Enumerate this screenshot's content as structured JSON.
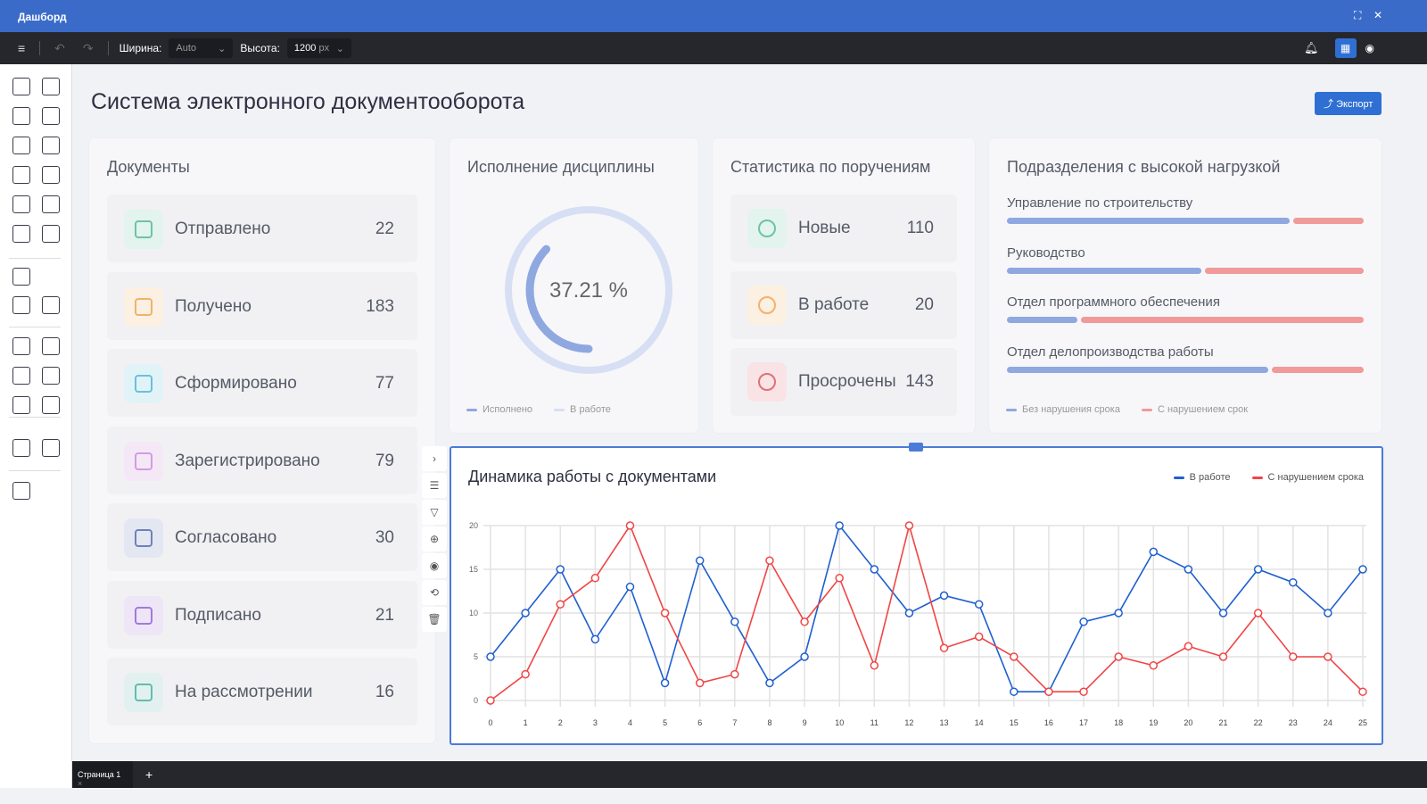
{
  "window": {
    "title": "Дашборд",
    "maximize_icon": "⛶",
    "close_icon": "✕"
  },
  "toolbar": {
    "width_label": "Ширина:",
    "width_value": "Auto",
    "height_label": "Высота:",
    "height_value": "1200",
    "height_unit": "px"
  },
  "page": {
    "title": "Система электронного документооборота",
    "export_label": "Экспорт"
  },
  "documents": {
    "title": "Документы",
    "items": [
      {
        "label": "Отправлено",
        "value": "22",
        "color": "#e3f3ee",
        "icon_color": "#6cc4a4"
      },
      {
        "label": "Получено",
        "value": "183",
        "color": "#fbf0e2",
        "icon_color": "#f2b26a"
      },
      {
        "label": "Сформировано",
        "value": "77",
        "color": "#e2f3f8",
        "icon_color": "#64c3de"
      },
      {
        "label": "Зарегистрировано",
        "value": "79",
        "color": "#f4e8f7",
        "icon_color": "#d49be3"
      },
      {
        "label": "Согласовано",
        "value": "30",
        "color": "#e3e7f2",
        "icon_color": "#6f82b8"
      },
      {
        "label": "Подписано",
        "value": "21",
        "color": "#eee6f7",
        "icon_color": "#a27ad9"
      },
      {
        "label": "На рассмотрении",
        "value": "16",
        "color": "#e2f1ef",
        "icon_color": "#5fbdb1"
      }
    ]
  },
  "discipline": {
    "title": "Исполнение дисциплины",
    "percent": 37.21,
    "percent_label": "37.21 %",
    "legend": [
      "Исполнено",
      "В работе"
    ]
  },
  "assignments": {
    "title": "Статистика по поручениям",
    "items": [
      {
        "label": "Новые",
        "value": "110",
        "color": "#e3f3ee",
        "icon_color": "#6cc4a4"
      },
      {
        "label": "В работе",
        "value": "20",
        "color": "#fbf0e2",
        "icon_color": "#f2b26a"
      },
      {
        "label": "Просрочены",
        "value": "143",
        "color": "#f9e3e5",
        "icon_color": "#e0707a"
      }
    ]
  },
  "departments": {
    "title": "Подразделения с высокой нагрузкой",
    "items": [
      {
        "name": "Управление по строительству",
        "ok": 80,
        "late": 20
      },
      {
        "name": "Руководство",
        "ok": 55,
        "late": 45
      },
      {
        "name": "Отдел программного обеспечения",
        "ok": 20,
        "late": 80
      },
      {
        "name": "Отдел делопроизводства работы",
        "ok": 74,
        "late": 26
      }
    ],
    "legend": [
      "Без нарушения срока",
      "С нарушением срок"
    ]
  },
  "chart_data": {
    "type": "line",
    "title": "Динамика работы с документами",
    "x": [
      0,
      1,
      2,
      3,
      4,
      5,
      6,
      7,
      8,
      9,
      10,
      11,
      12,
      13,
      14,
      15,
      16,
      17,
      18,
      19,
      20,
      21,
      22,
      23,
      24,
      25
    ],
    "yticks": [
      0,
      5,
      10,
      15,
      20
    ],
    "ylim": [
      0,
      20
    ],
    "legend_position": "top-right",
    "series": [
      {
        "name": "В работе",
        "color": "#1f5fcf",
        "values": [
          5,
          10,
          15,
          7,
          13,
          2,
          16,
          9,
          2,
          5,
          20,
          15,
          10,
          12,
          11,
          1,
          1,
          9,
          10,
          17,
          15,
          10,
          15,
          13.5,
          10,
          15
        ]
      },
      {
        "name": "С нарушением срока",
        "color": "#f04545",
        "values": [
          0,
          3,
          11,
          14,
          20,
          10,
          2,
          3,
          16,
          9,
          14,
          4,
          20,
          6,
          7.3,
          5,
          1,
          1,
          5,
          4,
          6.2,
          5,
          10,
          5,
          5,
          1
        ]
      }
    ]
  },
  "bottom": {
    "tab": "Страница 1",
    "close": "×",
    "add": "+"
  }
}
